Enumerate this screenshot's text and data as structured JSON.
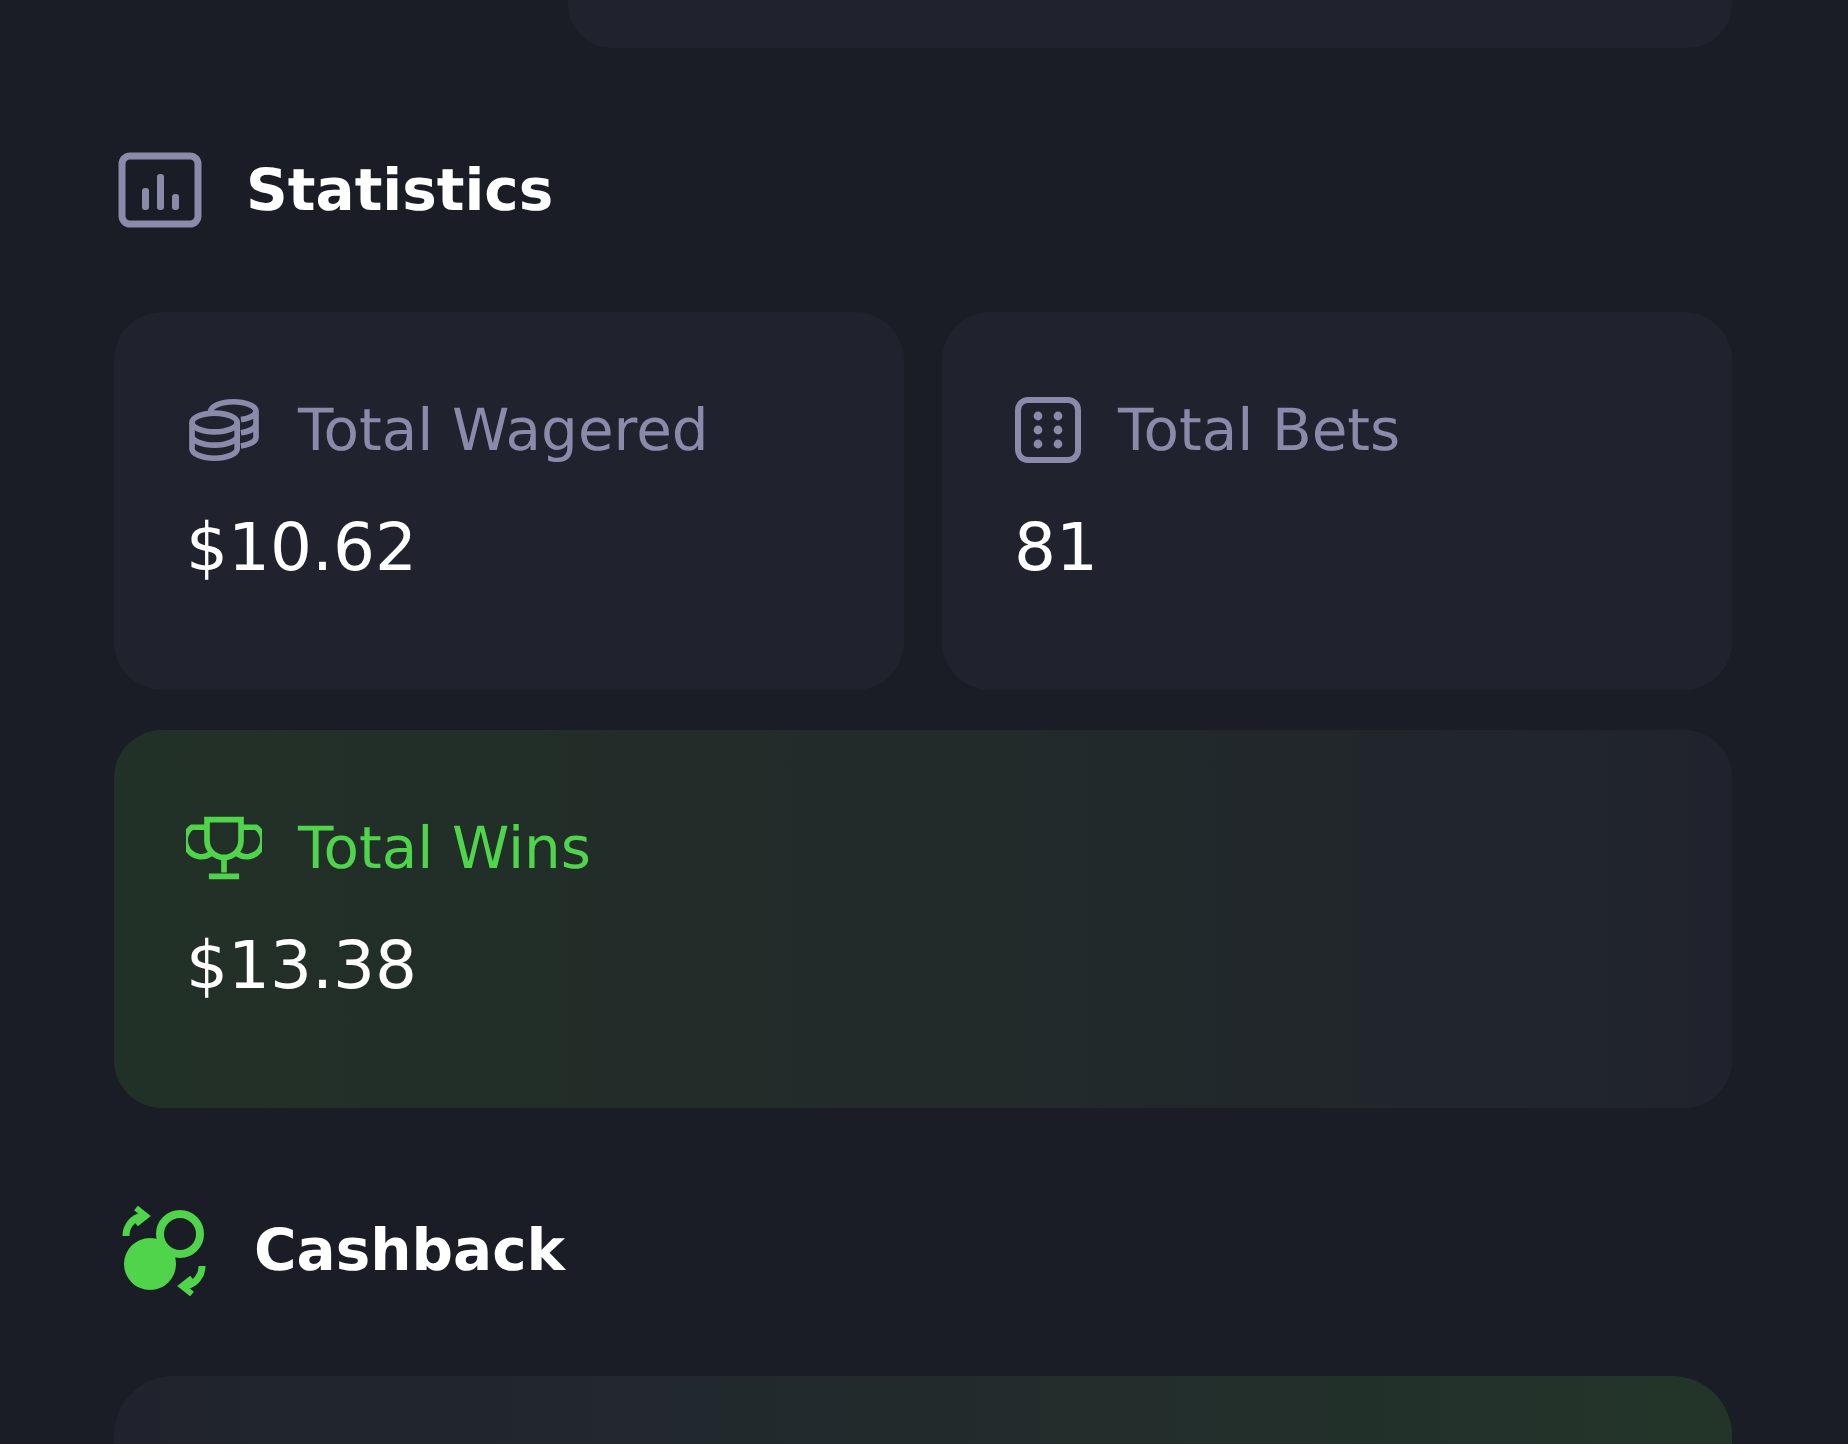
{
  "sections": [
    {
      "kind": "statistics",
      "title": "Statistics",
      "cards": [
        {
          "kind": "coins",
          "label": "Total Wagered",
          "value": "$10.62"
        },
        {
          "kind": "dice",
          "label": "Total Bets",
          "value": "81"
        },
        {
          "kind": "trophy",
          "label": "Total Wins",
          "value": "$13.38"
        }
      ]
    },
    {
      "kind": "cashback",
      "title": "Cashback"
    }
  ]
}
